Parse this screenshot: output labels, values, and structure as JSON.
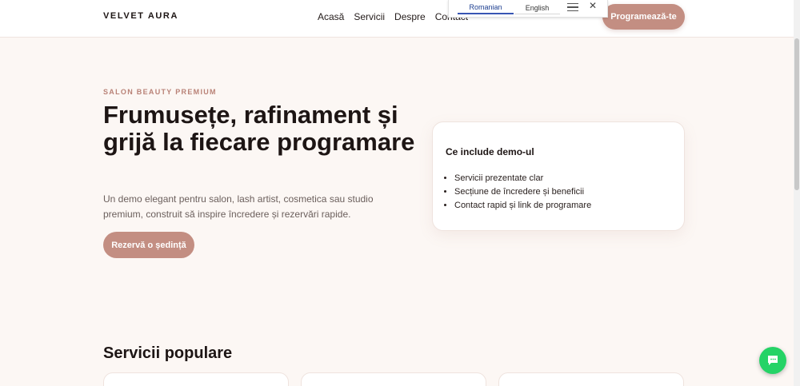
{
  "header": {
    "brand": "VELVET AURA",
    "nav": [
      "Acasă",
      "Servicii",
      "Despre",
      "Contact"
    ],
    "cta": "Programează-te"
  },
  "translate": {
    "lang_active": "Romanian",
    "lang_other": "English",
    "close": "✕"
  },
  "hero": {
    "eyebrow": "SALON BEAUTY PREMIUM",
    "title": "Frumusețe, rafinament și grijă la fiecare programare",
    "subtitle": "Un demo elegant pentru salon, lash artist, cosmetica sau studio premium, construit să inspire încredere și rezervări rapide.",
    "cta": "Rezervă o ședință"
  },
  "card": {
    "title": "Ce include demo-ul",
    "items": [
      "Servicii prezentate clar",
      "Secțiune de încredere și beneficii",
      "Contact rapid și link de programare"
    ]
  },
  "services": {
    "title": "Servicii populare"
  },
  "icons": {
    "menu": "hamburger-icon",
    "close": "close-icon",
    "chat": "chat-icon"
  },
  "colors": {
    "accent": "#c38e82",
    "background": "#fcf7f4",
    "chat": "#25d366"
  }
}
